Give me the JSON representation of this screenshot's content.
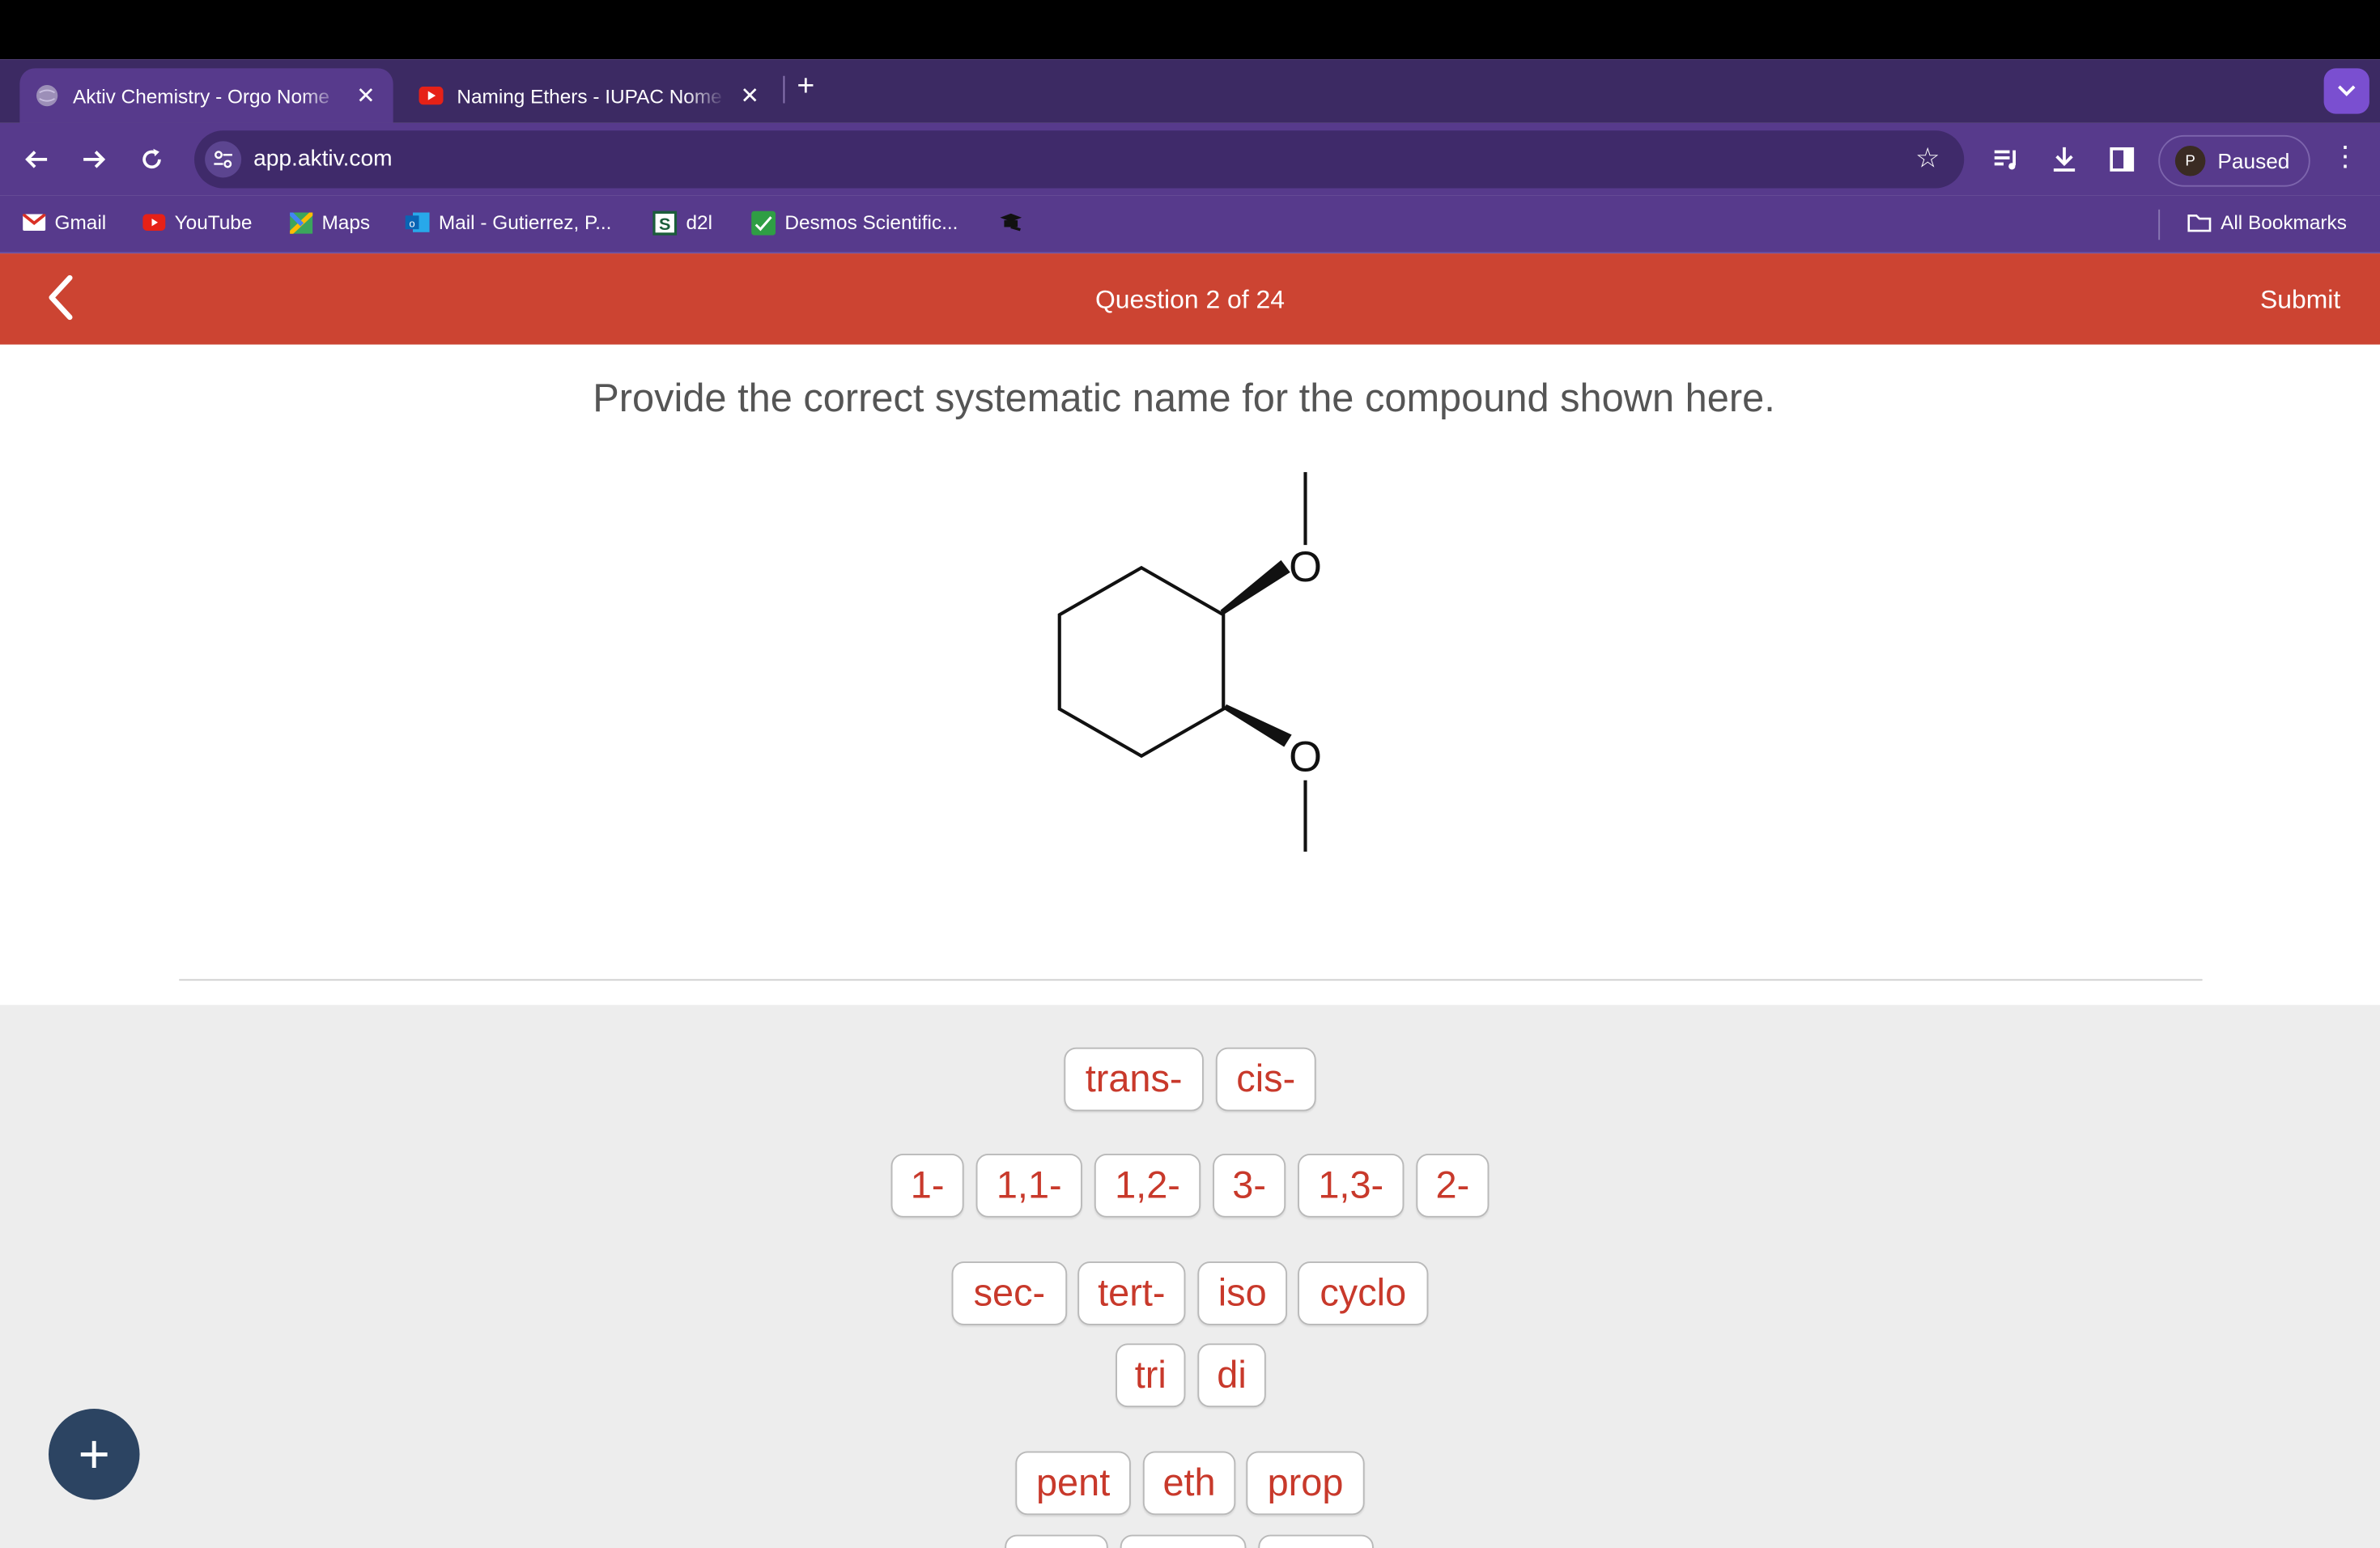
{
  "browser": {
    "tabs": [
      {
        "title": "Aktiv Chemistry - Orgo Nome",
        "active": true
      },
      {
        "title": "Naming Ethers - IUPAC Nome",
        "active": false
      }
    ],
    "url": "app.aktiv.com",
    "profile_initial": "P",
    "profile_status": "Paused",
    "bookmarks": [
      {
        "label": "Gmail",
        "icon": "gmail-icon"
      },
      {
        "label": "YouTube",
        "icon": "youtube-icon"
      },
      {
        "label": "Maps",
        "icon": "maps-icon"
      },
      {
        "label": "Mail - Gutierrez, P...",
        "icon": "outlook-icon"
      },
      {
        "label": "d2l",
        "icon": "d2l-icon"
      },
      {
        "label": "Desmos Scientific...",
        "icon": "desmos-icon"
      }
    ],
    "all_bookmarks": "All Bookmarks"
  },
  "app": {
    "question_title": "Question 2 of 24",
    "submit_label": "Submit",
    "prompt": "Provide the correct systematic name for the compound shown here.",
    "molecule_atoms": [
      "O",
      "O"
    ],
    "tile_rows": [
      [
        "trans-",
        "cis-"
      ],
      [
        "1-",
        "1,1-",
        "1,2-",
        "3-",
        "1,3-",
        "2-"
      ],
      [
        "sec-",
        "tert-",
        "iso",
        "cyclo"
      ],
      [
        "tri",
        "di"
      ],
      [
        "pent",
        "eth",
        "prop"
      ]
    ],
    "fab_label": "+"
  }
}
